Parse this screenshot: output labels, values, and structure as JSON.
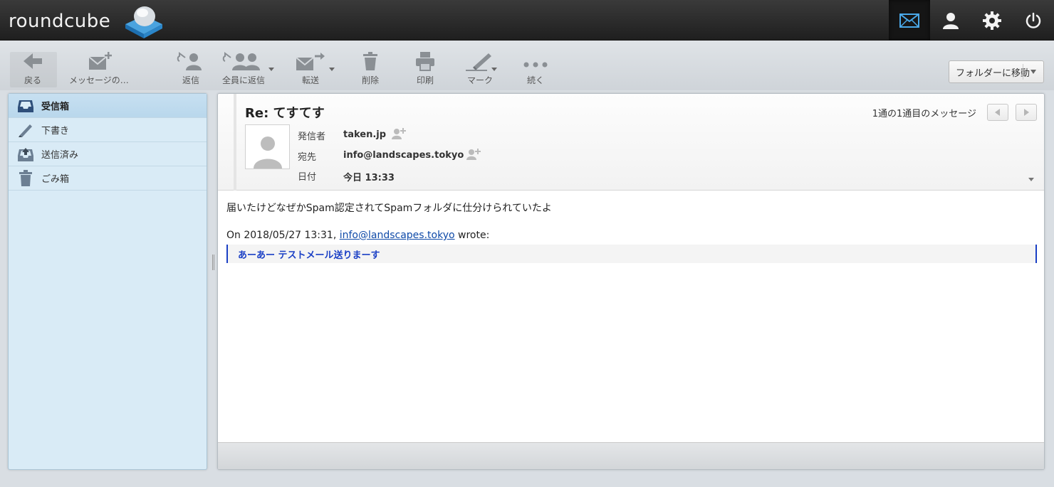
{
  "app": {
    "logo_text": "roundcube"
  },
  "topnav": {
    "items": [
      {
        "icon": "mail-icon",
        "active": true
      },
      {
        "icon": "contacts-icon",
        "active": false
      },
      {
        "icon": "settings-icon",
        "active": false
      },
      {
        "icon": "logout-icon",
        "active": false
      }
    ]
  },
  "toolbar": {
    "back": "戻る",
    "compose": "メッセージの…",
    "reply": "返信",
    "reply_all": "全員に返信",
    "forward": "転送",
    "delete": "削除",
    "print": "印刷",
    "mark": "マーク",
    "more": "続く",
    "move_to_folder": "フォルダーに移動"
  },
  "folders": [
    {
      "label": "受信箱",
      "icon": "inbox-icon",
      "selected": true
    },
    {
      "label": "下書き",
      "icon": "pencil-icon",
      "selected": false
    },
    {
      "label": "送信済み",
      "icon": "sent-icon",
      "selected": false
    },
    {
      "label": "ごみ箱",
      "icon": "trash-icon",
      "selected": false
    }
  ],
  "message": {
    "subject": "Re: てすてす",
    "count_info": "1通の1通目のメッセージ",
    "from_label": "発信者",
    "from_value": "taken.jp",
    "to_label": "宛先",
    "to_value": "info@landscapes.tokyo",
    "date_label": "日付",
    "date_value": "今日 13:33",
    "body_line1": "届いたけどなぜかSpam認定されてSpamフォルダに仕分けられていたよ",
    "quote_prefix": "On 2018/05/27 13:31, ",
    "quote_link": "info@landscapes.tokyo",
    "quote_suffix": " wrote:",
    "quoted_text": "あーあー テストメール送りまーす"
  },
  "colors": {
    "topbar": "#2a2a2a",
    "sidebar_bg": "#d9ebf6",
    "accent_blue": "#1a3fc5",
    "link": "#0f4aa8"
  }
}
